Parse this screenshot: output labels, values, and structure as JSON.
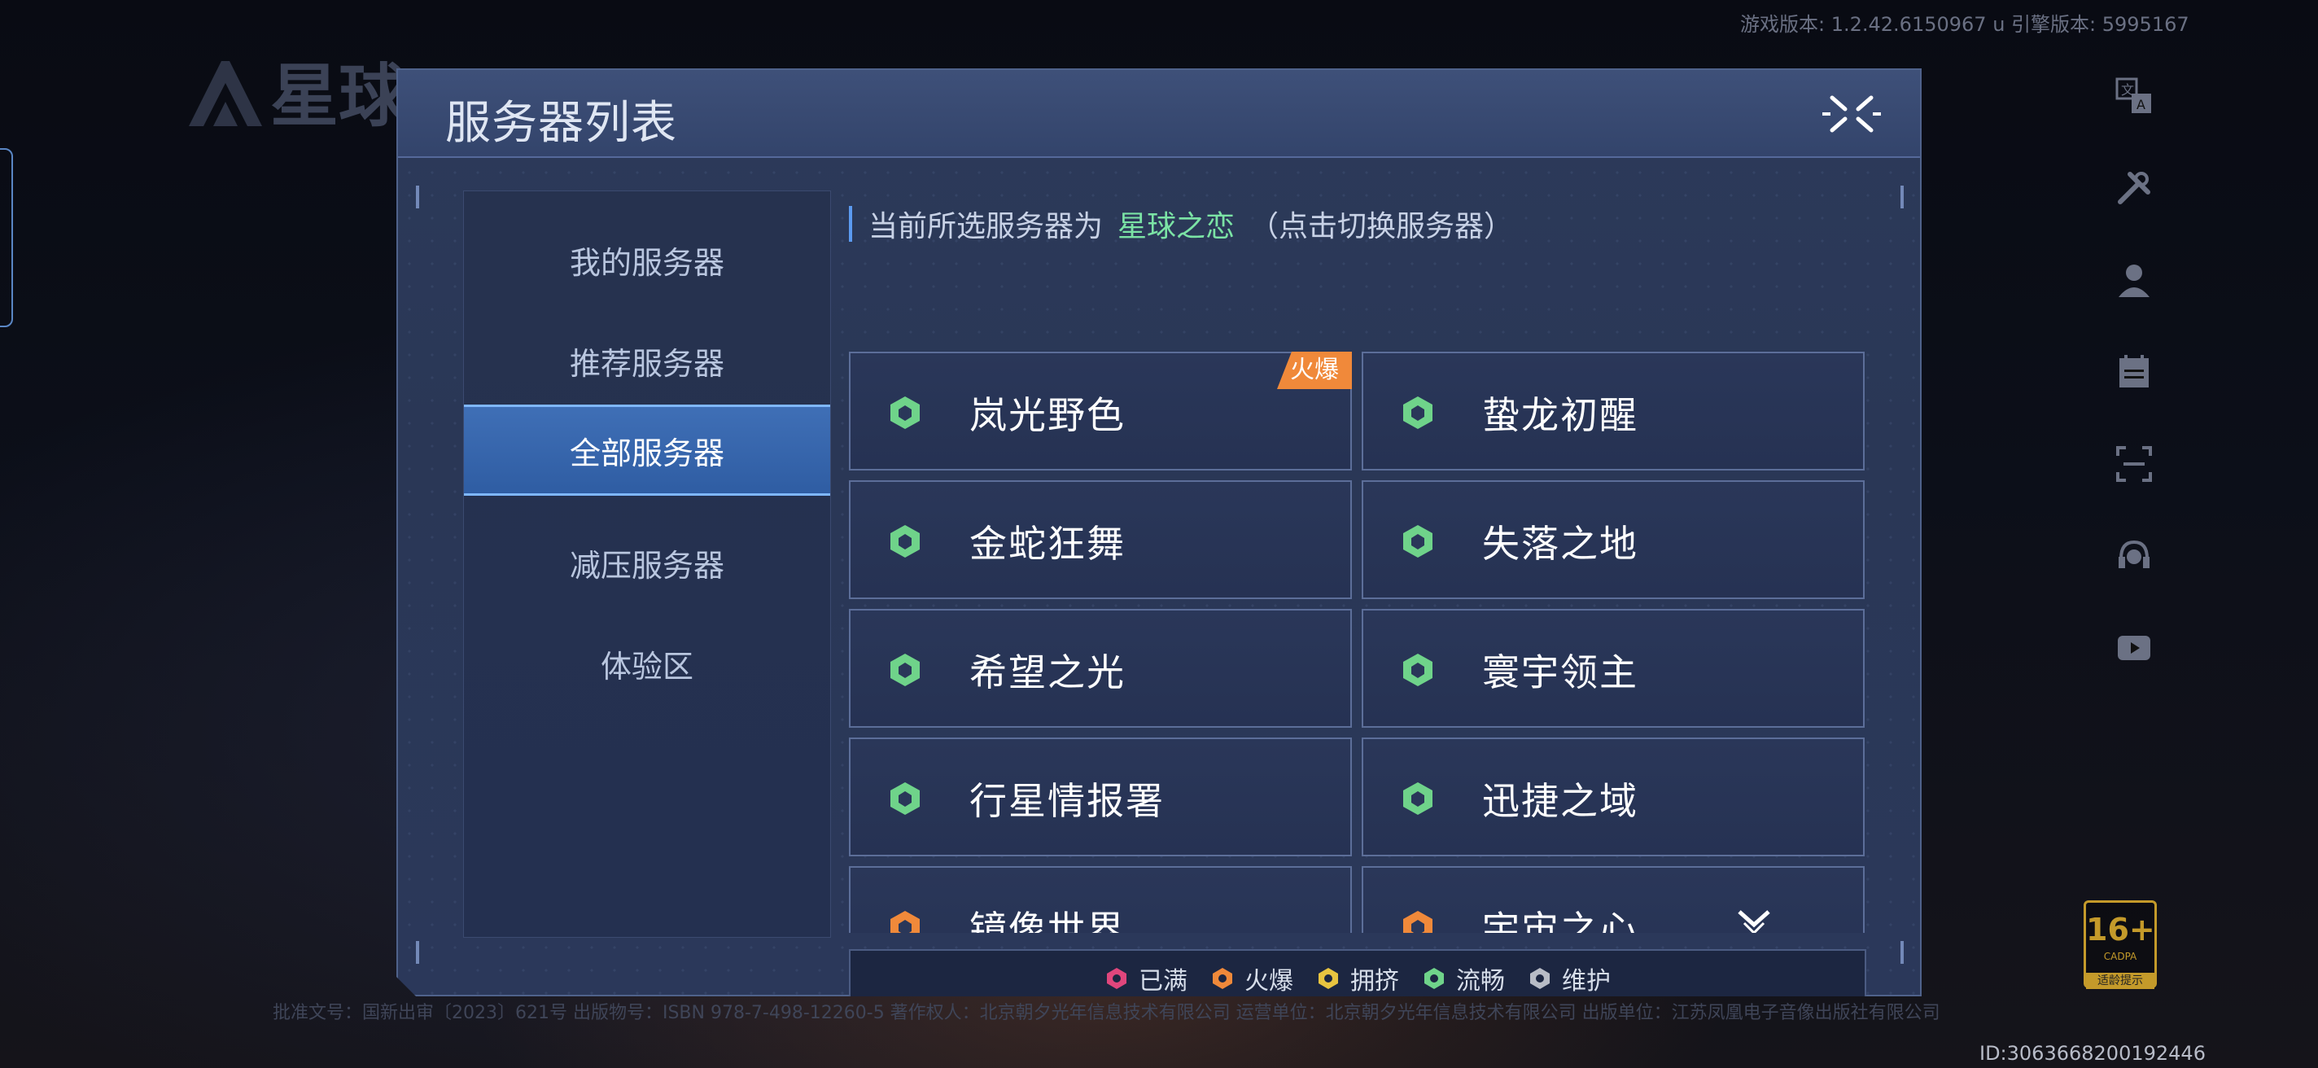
{
  "app": {
    "version_line": "游戏版本: 1.2.42.6150967 u  引擎版本: 5995167",
    "logo_text": "星球",
    "footer_license": "批准文号：国新出审〔2023〕621号  出版物号：ISBN 978-7-498-12260-5  著作权人：北京朝夕光年信息技术有限公司  运营单位：北京朝夕光年信息技术有限公司  出版单位：江苏凤凰电子音像出版社有限公司",
    "user_id": "ID:3063668200192446",
    "age_rating": {
      "age": "16+",
      "sub": "CADPA",
      "hint": "适龄提示"
    }
  },
  "side_icons": [
    "translate-icon",
    "tools-icon",
    "user-icon",
    "notice-icon",
    "scan-icon",
    "support-icon",
    "video-icon"
  ],
  "dialog": {
    "title": "服务器列表",
    "close_icon": "close-icon"
  },
  "sidebar": {
    "tabs": [
      {
        "label": "我的服务器",
        "active": false
      },
      {
        "label": "推荐服务器",
        "active": false
      },
      {
        "label": "全部服务器",
        "active": true
      },
      {
        "label": "减压服务器",
        "active": false
      },
      {
        "label": "体验区",
        "active": false
      }
    ]
  },
  "current": {
    "prefix": "当前所选服务器为",
    "server": "星球之恋",
    "hint": "（点击切换服务器）"
  },
  "servers": [
    {
      "name": "岚光野色",
      "status": "smooth",
      "tag": "火爆"
    },
    {
      "name": "蛰龙初醒",
      "status": "smooth",
      "tag": ""
    },
    {
      "name": "金蛇狂舞",
      "status": "smooth",
      "tag": ""
    },
    {
      "name": "失落之地",
      "status": "smooth",
      "tag": ""
    },
    {
      "name": "希望之光",
      "status": "smooth",
      "tag": ""
    },
    {
      "name": "寰宇领主",
      "status": "smooth",
      "tag": ""
    },
    {
      "name": "行星情报署",
      "status": "smooth",
      "tag": ""
    },
    {
      "name": "迅捷之域",
      "status": "smooth",
      "tag": ""
    },
    {
      "name": "镜像世界",
      "status": "hot",
      "tag": ""
    },
    {
      "name": "宇宙之心",
      "status": "hot",
      "tag": ""
    }
  ],
  "legend": [
    {
      "label": "已满",
      "color": "#e0467c"
    },
    {
      "label": "火爆",
      "color": "#f0893a"
    },
    {
      "label": "拥挤",
      "color": "#e8c440"
    },
    {
      "label": "流畅",
      "color": "#6fd38a"
    },
    {
      "label": "维护",
      "color": "#b8bcc6"
    }
  ],
  "colors": {
    "smooth": "#6fd38a",
    "hot": "#f0893a",
    "accent": "#5b9af0",
    "selected_server": "#7be3a5"
  }
}
